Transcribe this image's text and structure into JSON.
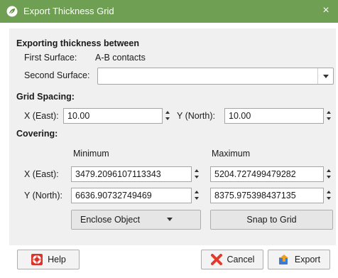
{
  "window": {
    "title": "Export Thickness Grid",
    "close_glyph": "×",
    "colors": {
      "titlebar": "#6e9f53",
      "panel": "#f0f0f0"
    }
  },
  "exporting": {
    "heading": "Exporting thickness between",
    "first_surface_label": "First Surface:",
    "first_surface_value": "A-B contacts",
    "second_surface_label": "Second Surface:",
    "second_surface_value": ""
  },
  "grid_spacing": {
    "heading": "Grid Spacing:",
    "x_label": "X (East):",
    "x_value": "10.00",
    "y_label": "Y (North):",
    "y_value": "10.00"
  },
  "covering": {
    "heading": "Covering:",
    "min_header": "Minimum",
    "max_header": "Maximum",
    "x_label": "X (East):",
    "x_min": "3479.2096107113343",
    "x_max": "5204.727499479282",
    "y_label": "Y (North):",
    "y_min": "6636.90732749469",
    "y_max": "8375.975398437135",
    "enclose_label": "Enclose Object",
    "snap_label": "Snap to Grid"
  },
  "footer": {
    "help_label": "Help",
    "cancel_label": "Cancel",
    "export_label": "Export"
  },
  "icons": [
    "app-leaf-icon",
    "close-icon",
    "help-lifebuoy-icon",
    "cancel-x-icon",
    "export-icon",
    "chevron-down-icon",
    "spin-up-icon",
    "spin-down-icon"
  ]
}
